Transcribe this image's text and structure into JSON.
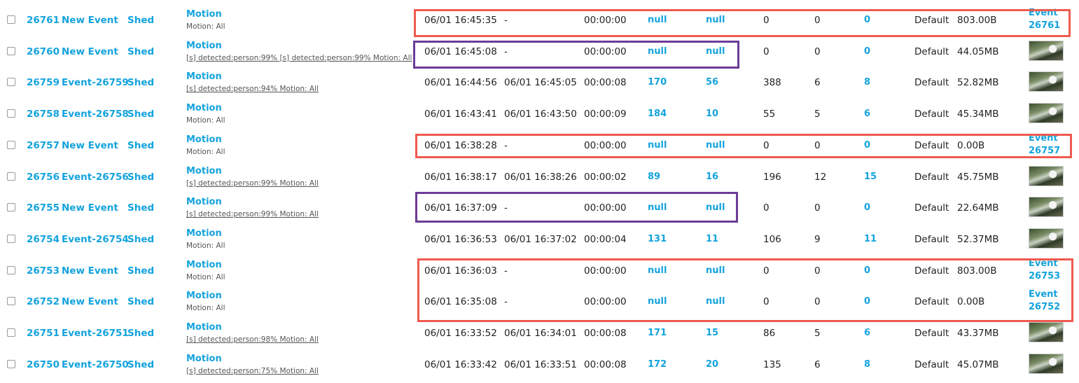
{
  "colors": {
    "link": "#14a3dd",
    "highlight_red": "#ee5a4f",
    "highlight_purple": "#6d3b98"
  },
  "events": [
    {
      "id": "26761",
      "name": "New Event",
      "monitor": "Shed",
      "cause": "Motion",
      "notes": "Motion: All",
      "notes_link": false,
      "start": "06/01 16:45:35",
      "end": "-",
      "duration": "00:00:00",
      "frames": "null",
      "alarm_frames": "null",
      "total_score": "0",
      "avg_score": "0",
      "max_score": "0",
      "storage": "Default",
      "size": "803.00B",
      "thumb": false,
      "event_link_1": "Event",
      "event_link_2": "26761"
    },
    {
      "id": "26760",
      "name": "New Event",
      "monitor": "Shed",
      "cause": "Motion",
      "notes": "[s] detected:person:99% [s] detected:person:99% Motion: All",
      "notes_link": true,
      "start": "06/01 16:45:08",
      "end": "-",
      "duration": "00:00:00",
      "frames": "null",
      "alarm_frames": "null",
      "total_score": "0",
      "avg_score": "0",
      "max_score": "0",
      "storage": "Default",
      "size": "44.05MB",
      "thumb": true
    },
    {
      "id": "26759",
      "name": "Event-26759",
      "monitor": "Shed",
      "cause": "Motion",
      "notes": "[s] detected:person:94% Motion: All",
      "notes_link": true,
      "start": "06/01 16:44:56",
      "end": "06/01 16:45:05",
      "duration": "00:00:08",
      "frames": "170",
      "alarm_frames": "56",
      "total_score": "388",
      "avg_score": "6",
      "max_score": "8",
      "storage": "Default",
      "size": "52.82MB",
      "thumb": true
    },
    {
      "id": "26758",
      "name": "Event-26758",
      "monitor": "Shed",
      "cause": "Motion",
      "notes": "Motion: All",
      "notes_link": false,
      "start": "06/01 16:43:41",
      "end": "06/01 16:43:50",
      "duration": "00:00:09",
      "frames": "184",
      "alarm_frames": "10",
      "total_score": "55",
      "avg_score": "5",
      "max_score": "6",
      "storage": "Default",
      "size": "45.34MB",
      "thumb": true
    },
    {
      "id": "26757",
      "name": "New Event",
      "monitor": "Shed",
      "cause": "Motion",
      "notes": "Motion: All",
      "notes_link": false,
      "start": "06/01 16:38:28",
      "end": "-",
      "duration": "00:00:00",
      "frames": "null",
      "alarm_frames": "null",
      "total_score": "0",
      "avg_score": "0",
      "max_score": "0",
      "storage": "Default",
      "size": "0.00B",
      "thumb": false,
      "event_link_1": "Event",
      "event_link_2": "26757"
    },
    {
      "id": "26756",
      "name": "Event-26756",
      "monitor": "Shed",
      "cause": "Motion",
      "notes": "[s] detected:person:99% Motion: All",
      "notes_link": true,
      "start": "06/01 16:38:17",
      "end": "06/01 16:38:26",
      "duration": "00:00:02",
      "frames": "89",
      "alarm_frames": "16",
      "total_score": "196",
      "avg_score": "12",
      "max_score": "15",
      "storage": "Default",
      "size": "45.75MB",
      "thumb": true
    },
    {
      "id": "26755",
      "name": "New Event",
      "monitor": "Shed",
      "cause": "Motion",
      "notes": "[s] detected:person:99% Motion: All",
      "notes_link": true,
      "start": "06/01 16:37:09",
      "end": "-",
      "duration": "00:00:00",
      "frames": "null",
      "alarm_frames": "null",
      "total_score": "0",
      "avg_score": "0",
      "max_score": "0",
      "storage": "Default",
      "size": "22.64MB",
      "thumb": true
    },
    {
      "id": "26754",
      "name": "Event-26754",
      "monitor": "Shed",
      "cause": "Motion",
      "notes": "Motion: All",
      "notes_link": false,
      "start": "06/01 16:36:53",
      "end": "06/01 16:37:02",
      "duration": "00:00:04",
      "frames": "131",
      "alarm_frames": "11",
      "total_score": "106",
      "avg_score": "9",
      "max_score": "11",
      "storage": "Default",
      "size": "52.37MB",
      "thumb": true
    },
    {
      "id": "26753",
      "name": "New Event",
      "monitor": "Shed",
      "cause": "Motion",
      "notes": "Motion: All",
      "notes_link": false,
      "start": "06/01 16:36:03",
      "end": "-",
      "duration": "00:00:00",
      "frames": "null",
      "alarm_frames": "null",
      "total_score": "0",
      "avg_score": "0",
      "max_score": "0",
      "storage": "Default",
      "size": "803.00B",
      "thumb": false,
      "event_link_1": "Event",
      "event_link_2": "26753"
    },
    {
      "id": "26752",
      "name": "New Event",
      "monitor": "Shed",
      "cause": "Motion",
      "notes": "Motion: All",
      "notes_link": false,
      "start": "06/01 16:35:08",
      "end": "-",
      "duration": "00:00:00",
      "frames": "null",
      "alarm_frames": "null",
      "total_score": "0",
      "avg_score": "0",
      "max_score": "0",
      "storage": "Default",
      "size": "0.00B",
      "thumb": false,
      "event_link_1": "Event",
      "event_link_2": "26752"
    },
    {
      "id": "26751",
      "name": "Event-26751",
      "monitor": "Shed",
      "cause": "Motion",
      "notes": "[s] detected:person:98% Motion: All",
      "notes_link": true,
      "start": "06/01 16:33:52",
      "end": "06/01 16:34:01",
      "duration": "00:00:08",
      "frames": "171",
      "alarm_frames": "15",
      "total_score": "86",
      "avg_score": "5",
      "max_score": "6",
      "storage": "Default",
      "size": "43.37MB",
      "thumb": true
    },
    {
      "id": "26750",
      "name": "Event-26750",
      "monitor": "Shed",
      "cause": "Motion",
      "notes": "[s] detected:person:75% Motion: All",
      "notes_link": true,
      "start": "06/01 16:33:42",
      "end": "06/01 16:33:51",
      "duration": "00:00:08",
      "frames": "172",
      "alarm_frames": "20",
      "total_score": "135",
      "avg_score": "6",
      "max_score": "8",
      "storage": "Default",
      "size": "45.07MB",
      "thumb": true
    }
  ]
}
